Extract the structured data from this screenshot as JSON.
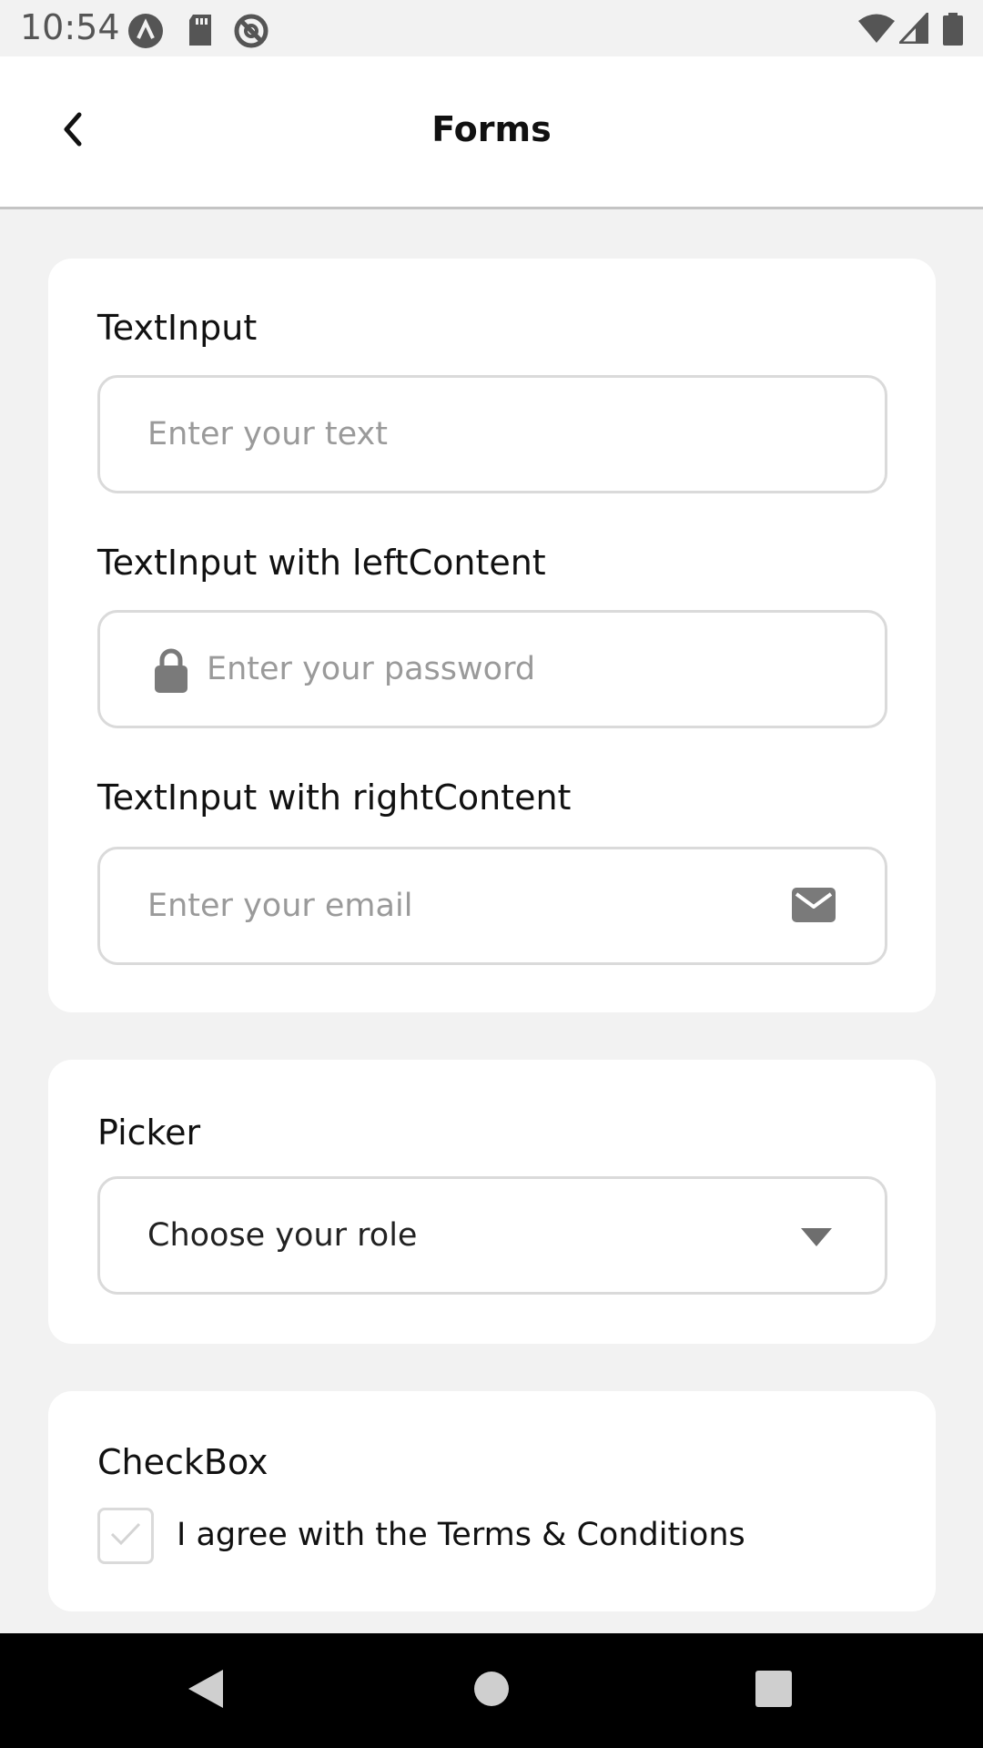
{
  "status_bar": {
    "time": "10:54",
    "left_icons": [
      "android-notification-icon",
      "sd-card-icon",
      "no-disturb-icon"
    ],
    "right_icons": [
      "wifi-icon",
      "cell-signal-icon",
      "battery-icon"
    ]
  },
  "header": {
    "title": "Forms",
    "back_icon": "chevron-left-icon"
  },
  "text_inputs_card": {
    "text_input": {
      "label": "TextInput",
      "placeholder": "Enter your text"
    },
    "left_content_input": {
      "label": "TextInput with leftContent",
      "placeholder": "Enter your password",
      "icon": "lock-icon"
    },
    "right_content_input": {
      "label": "TextInput with rightContent",
      "placeholder": "Enter your email",
      "icon": "mail-icon"
    }
  },
  "picker_card": {
    "label": "Picker",
    "selected": "Choose your role",
    "icon": "caret-down-icon"
  },
  "checkbox_card": {
    "label": "CheckBox",
    "option_label": "I agree with the Terms & Conditions",
    "checked": false
  },
  "nav_bar": {
    "buttons": [
      "back-triangle-icon",
      "home-circle-icon",
      "recents-square-icon"
    ]
  },
  "colors": {
    "background": "#f2f2f2",
    "card": "#ffffff",
    "border": "#dadada",
    "placeholder": "#9a9a9a",
    "icon_gray": "#777777"
  }
}
